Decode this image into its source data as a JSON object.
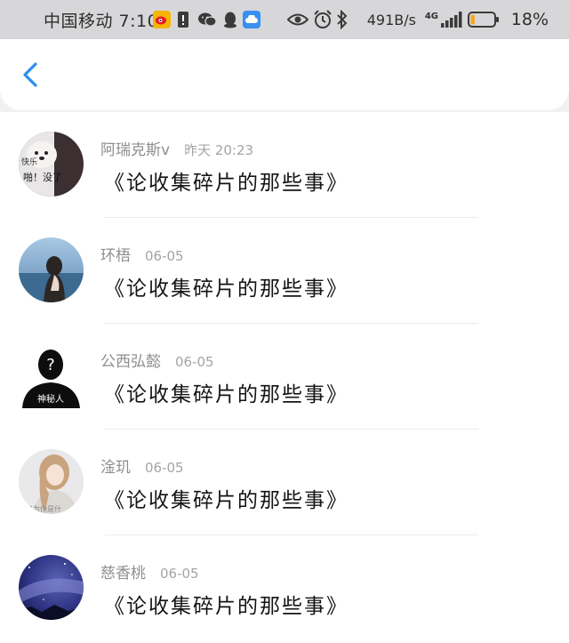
{
  "status_bar": {
    "carrier_time": "中国移动 7:10",
    "net_speed": "491B/s",
    "network_type": "4G",
    "battery_percent": "18%",
    "battery_level": 0.18,
    "battery_color": "#f5a623",
    "icons": [
      "weibo-icon",
      "sim-alert-icon",
      "wechat-icon",
      "qq-icon",
      "cloud-icon",
      "eye-icon",
      "alarm-icon",
      "bluetooth-icon",
      "signal-icon",
      "battery-icon"
    ]
  },
  "header": {
    "back_icon": "chevron-left-icon",
    "accent_color": "#2b8ff0"
  },
  "feed": {
    "items": [
      {
        "author": "阿瑞克斯v",
        "time": "昨天 20:23",
        "title": "《论收集碎片的那些事》",
        "avatar_text_1": "快乐",
        "avatar_text_2": "啪！没了"
      },
      {
        "author": "环梧",
        "time": "06-05",
        "title": "《论收集碎片的那些事》"
      },
      {
        "author": "公西弘懿",
        "time": "06-05",
        "title": "《论收集碎片的那些事》",
        "avatar_text_1": "神秘人"
      },
      {
        "author": "淦玑",
        "time": "06-05",
        "title": "《论收集碎片的那些事》",
        "avatar_text_1": "只为你是什"
      },
      {
        "author": "慈香桃",
        "time": "06-05",
        "title": "《论收集碎片的那些事》"
      }
    ]
  }
}
